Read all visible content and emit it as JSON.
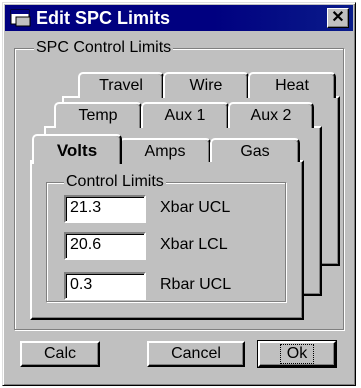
{
  "window": {
    "title": "Edit SPC Limits",
    "close_glyph": "✕",
    "icon": "app-window-icon"
  },
  "group": {
    "label": "SPC Control Limits"
  },
  "tabs": {
    "row_back": [
      "Travel",
      "Wire",
      "Heat"
    ],
    "row_middle": [
      "Temp",
      "Aux 1",
      "Aux 2"
    ],
    "row_front": [
      "Volts",
      "Amps",
      "Gas"
    ],
    "selected": "Volts"
  },
  "control_limits": {
    "label": "Control Limits",
    "fields": [
      {
        "label": "Xbar UCL",
        "value": "21.3"
      },
      {
        "label": "Xbar LCL",
        "value": "20.6"
      },
      {
        "label": "Rbar UCL",
        "value": "0.3"
      }
    ]
  },
  "buttons": {
    "calc": "Calc",
    "cancel": "Cancel",
    "ok": "Ok"
  },
  "colors": {
    "title_bar": "#000080",
    "face": "#c0c0c0"
  }
}
